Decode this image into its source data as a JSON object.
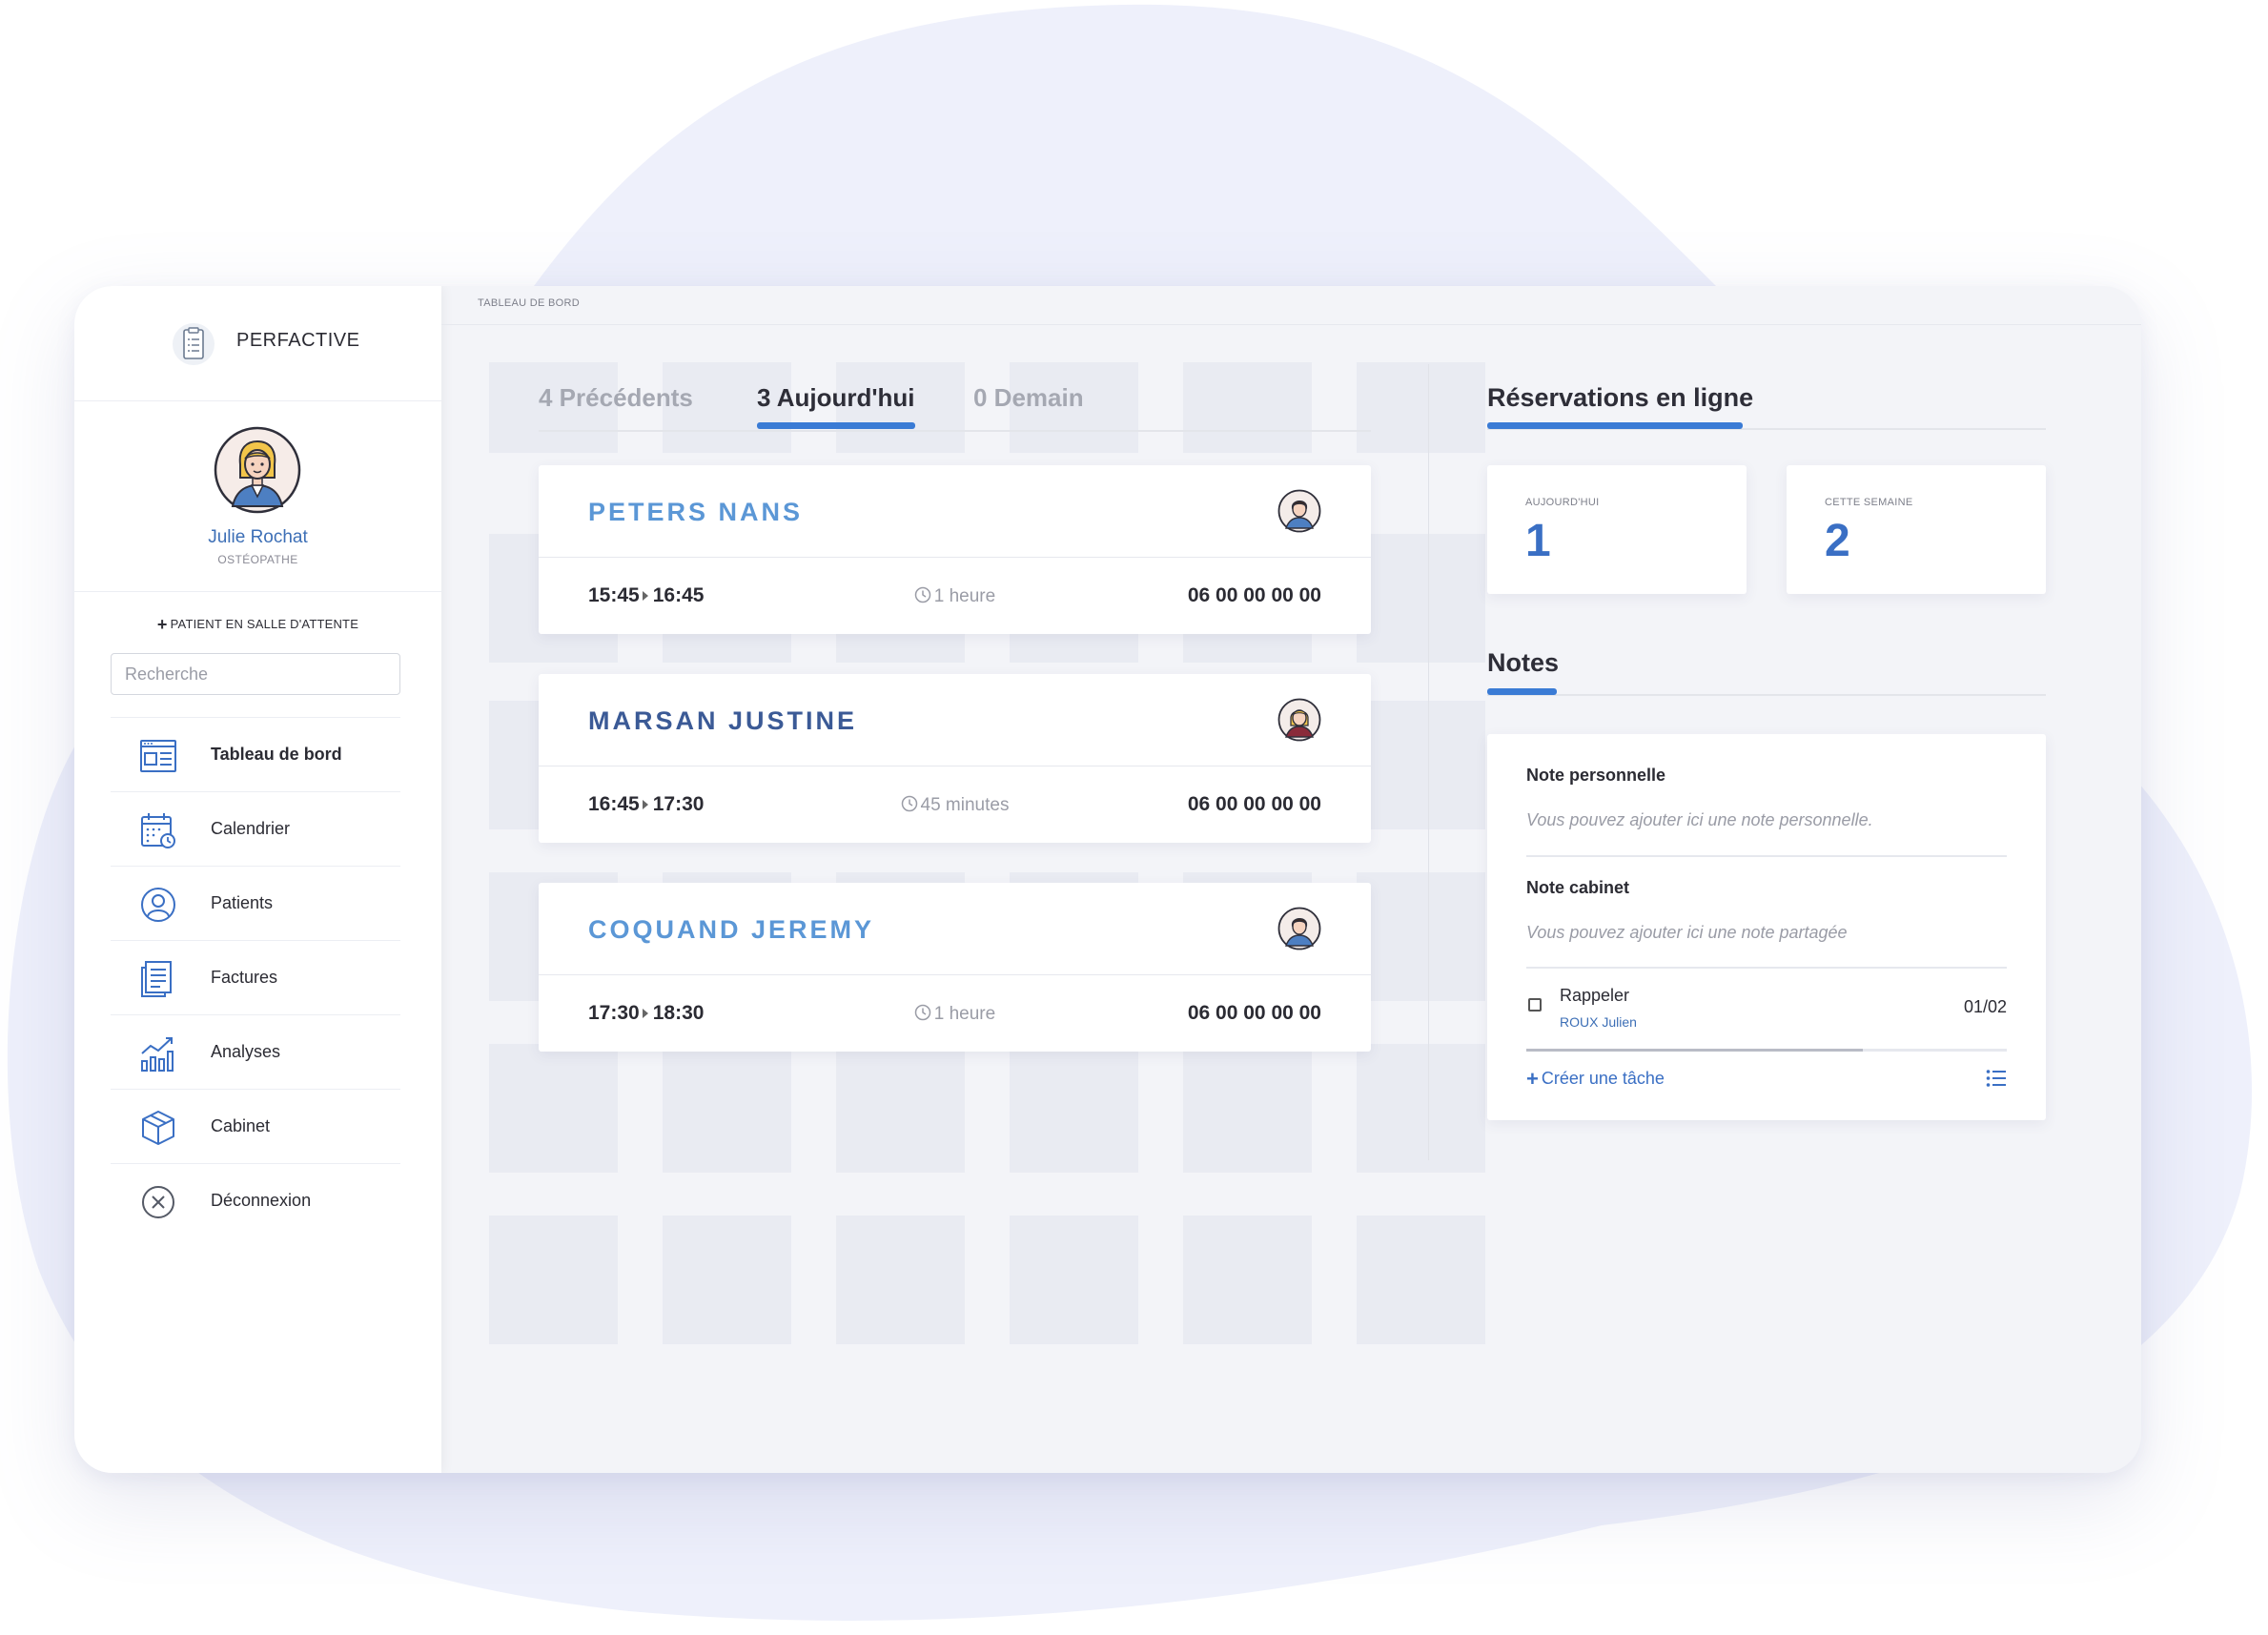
{
  "brand": {
    "name": "PERFACTIVE",
    "logo_icon": "clipboard-icon"
  },
  "profile": {
    "name": "Julie Rochat",
    "role": "OSTÉOPATHE"
  },
  "sidebar": {
    "add_patient_label": "PATIENT EN SALLE D'ATTENTE",
    "search_placeholder": "Recherche",
    "items": [
      {
        "label": "Tableau de bord",
        "icon": "dashboard-icon",
        "active": true
      },
      {
        "label": "Calendrier",
        "icon": "calendar-icon"
      },
      {
        "label": "Patients",
        "icon": "user-icon"
      },
      {
        "label": "Factures",
        "icon": "invoice-icon"
      },
      {
        "label": "Analyses",
        "icon": "chart-icon"
      },
      {
        "label": "Cabinet",
        "icon": "box-icon"
      },
      {
        "label": "Déconnexion",
        "icon": "logout-icon"
      }
    ]
  },
  "breadcrumb": "TABLEAU DE BORD",
  "tabs": [
    {
      "label": "4 Précédents",
      "active": false
    },
    {
      "label": "3 Aujourd'hui",
      "active": true
    },
    {
      "label": "0 Demain",
      "active": false
    }
  ],
  "appointments": [
    {
      "name": "PETERS NANS",
      "name_color": "#5b97d6",
      "start": "15:45",
      "end": "16:45",
      "duration": "1 heure",
      "phone": "06 00 00 00 00",
      "avatar": "male-avatar-icon"
    },
    {
      "name": "MARSAN JUSTINE",
      "name_color": "#3b5a96",
      "start": "16:45",
      "end": "17:30",
      "duration": "45 minutes",
      "phone": "06 00 00 00 00",
      "avatar": "female-avatar-icon"
    },
    {
      "name": "COQUAND JEREMY",
      "name_color": "#5b97d6",
      "start": "17:30",
      "end": "18:30",
      "duration": "1 heure",
      "phone": "06 00 00 00 00",
      "avatar": "male-avatar-icon"
    }
  ],
  "reservations": {
    "title": "Réservations en ligne",
    "today": {
      "label": "AUJOURD'HUI",
      "value": "1"
    },
    "week": {
      "label": "CETTE SEMAINE",
      "value": "2"
    }
  },
  "notes": {
    "title": "Notes",
    "personal": {
      "title": "Note personnelle",
      "placeholder": "Vous pouvez ajouter ici une note personnelle."
    },
    "cabinet": {
      "title": "Note cabinet",
      "placeholder": "Vous pouvez ajouter ici une note partagée"
    },
    "task": {
      "name": "Rappeler",
      "patient": "ROUX Julien",
      "date": "01/02",
      "progress": 0.7
    },
    "create_task_label": "Créer une tâche"
  },
  "colors": {
    "accent": "#3a7bd5",
    "background_blob": "#eef0fb"
  }
}
